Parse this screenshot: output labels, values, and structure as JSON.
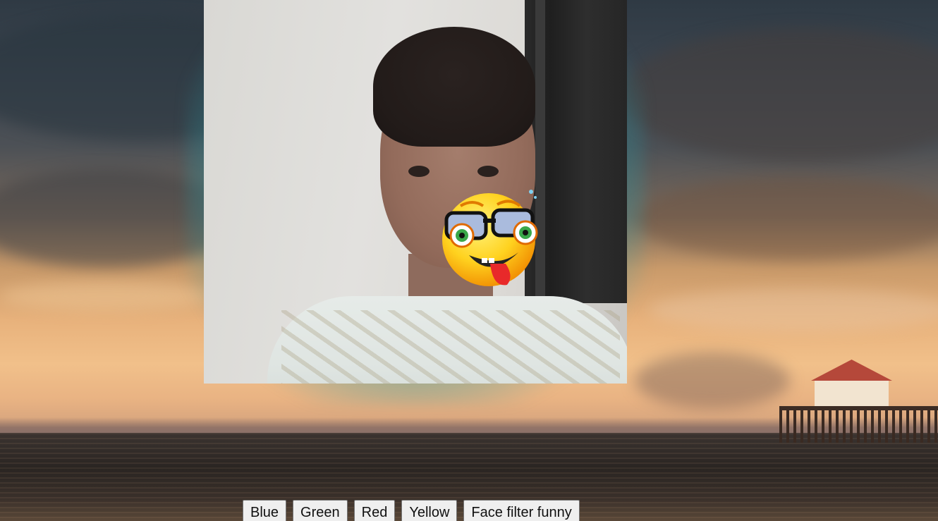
{
  "filter_buttons": {
    "blue_label": "Blue",
    "green_label": "Green",
    "red_label": "Red",
    "yellow_label": "Yellow",
    "face_filter_label": "Face filter funny"
  },
  "video": {
    "overlay_sticker_icon": "nerd-emoji-icon",
    "glow_color": "#2896a0"
  },
  "background": {
    "scene": "sunset-ocean-pier"
  }
}
